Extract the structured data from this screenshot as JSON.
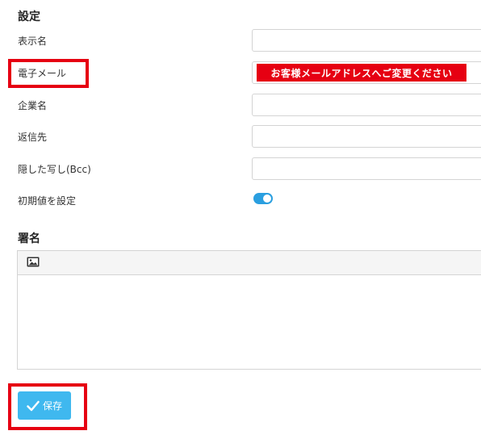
{
  "settings": {
    "title": "設定",
    "fields": [
      {
        "label": "表示名",
        "value": ""
      },
      {
        "label": "電子メール",
        "value": ""
      },
      {
        "label": "企業名",
        "value": ""
      },
      {
        "label": "返信先",
        "value": ""
      },
      {
        "label": "隠した写し(Bcc)",
        "value": ""
      }
    ],
    "default_toggle": {
      "label": "初期値を設定",
      "on": true
    },
    "email_notice": "お客様メールアドレスへご変更ください"
  },
  "signature": {
    "title": "署名",
    "toolbar_icon": "image-icon",
    "content": ""
  },
  "actions": {
    "save_label": "保存",
    "save_icon": "check-icon"
  },
  "colors": {
    "accent": "#3fb8ef",
    "toggle_on": "#2a9fe0",
    "highlight": "#e60012"
  }
}
